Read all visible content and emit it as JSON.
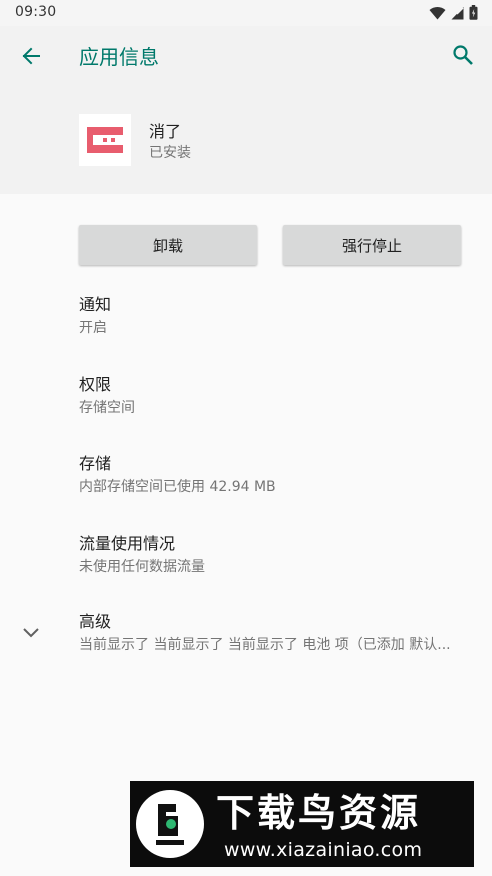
{
  "status_bar": {
    "time": "09:30",
    "icons": [
      "wifi-icon",
      "signal-icon",
      "battery-icon"
    ]
  },
  "app_bar": {
    "title": "应用信息",
    "back_icon": "arrow-left-icon",
    "search_icon": "search-icon"
  },
  "app": {
    "name": "消了",
    "status": "已安装",
    "icon_color": "#e85d6e"
  },
  "buttons": {
    "uninstall": "卸载",
    "force_stop": "强行停止"
  },
  "preferences": [
    {
      "title": "通知",
      "summary": "开启"
    },
    {
      "title": "权限",
      "summary": "存储空间"
    },
    {
      "title": "存储",
      "summary": "内部存储空间已使用 42.94 MB"
    },
    {
      "title": "流量使用情况",
      "summary": "未使用任何数据流量"
    },
    {
      "title": "高级",
      "summary": "当前显示了 当前显示了 当前显示了 电池 项（已添加 默认..."
    }
  ],
  "watermark": {
    "title": "下载鸟资源",
    "url": "www.xiazainiao.com"
  },
  "colors": {
    "accent": "#00796b",
    "background": "#fafafa",
    "header_background": "#f2f2f2",
    "button_background": "#d8d9d9"
  }
}
